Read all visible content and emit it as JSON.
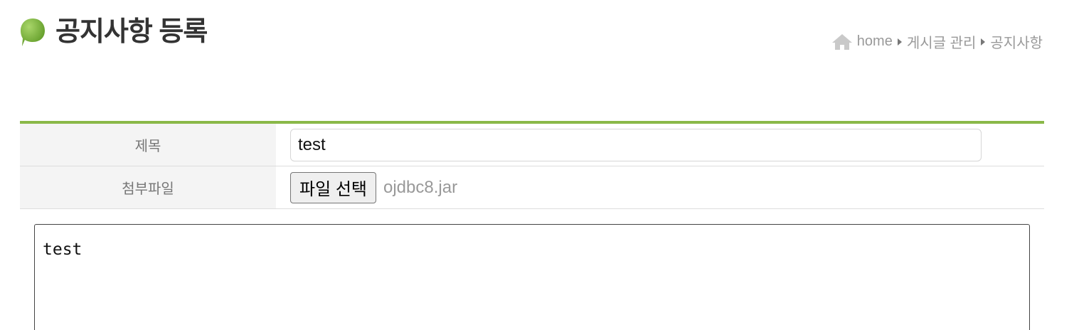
{
  "header": {
    "title": "공지사항 등록",
    "icon": "leaf-icon",
    "accent_color": "#8ab848"
  },
  "breadcrumb": {
    "icon": "home-icon",
    "items": [
      "home",
      "게시글 관리",
      "공지사항"
    ]
  },
  "form": {
    "title_label": "제목",
    "title_value": "test",
    "attachment_label": "첨부파일",
    "file_button_label": "파일 선택",
    "file_name": "ojdbc8.jar"
  },
  "editor": {
    "content": "test"
  }
}
